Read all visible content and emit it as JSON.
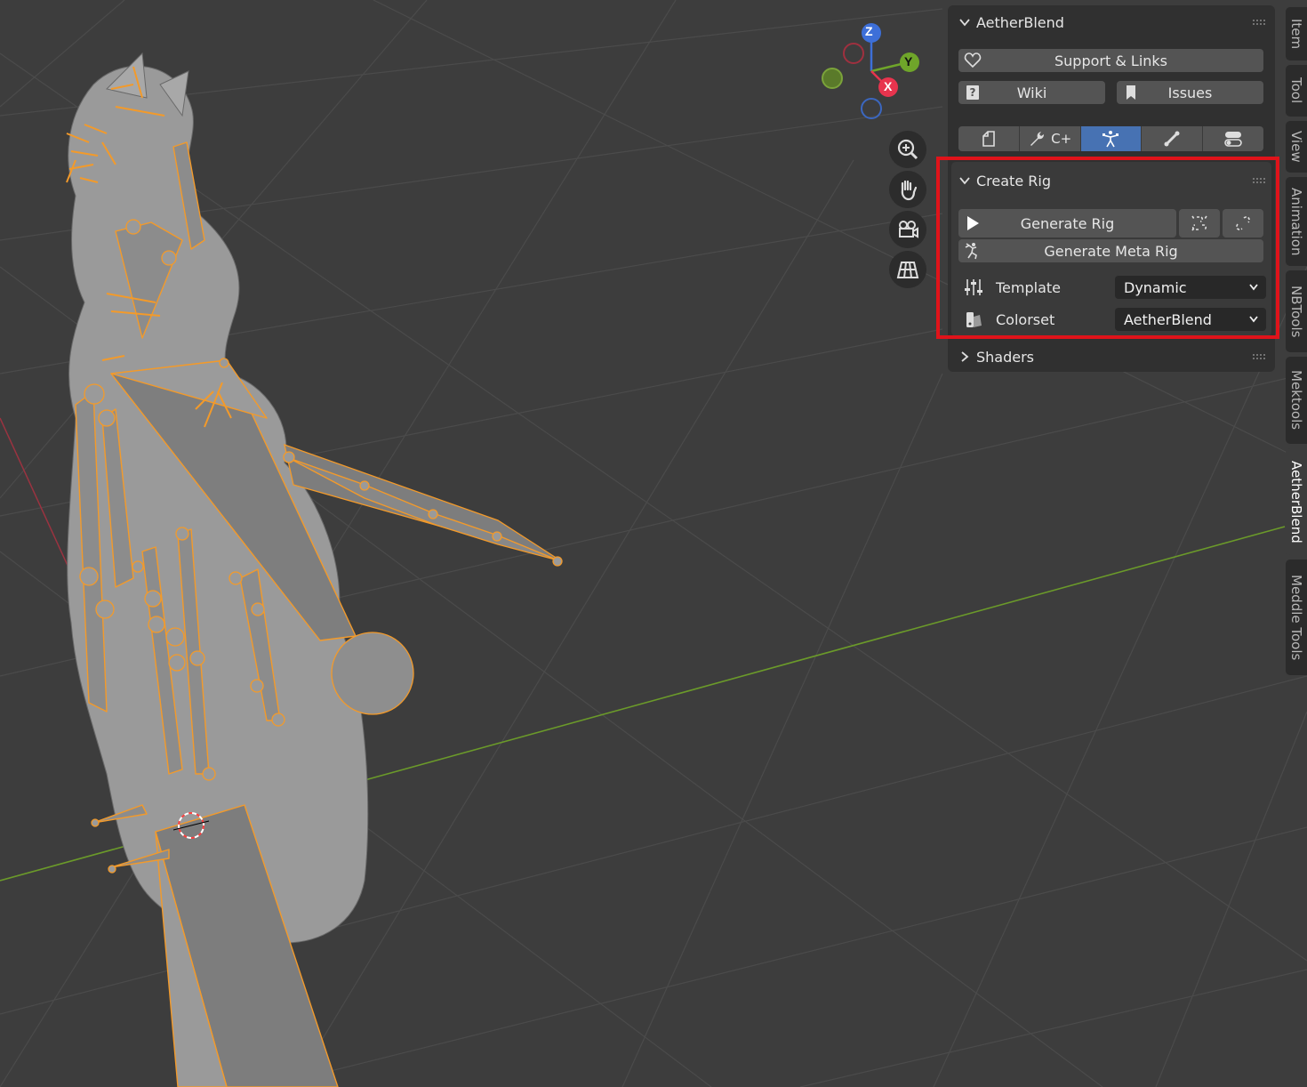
{
  "addon": {
    "title": "AetherBlend",
    "support_label": "Support & Links",
    "wiki_label": "Wiki",
    "issues_label": "Issues"
  },
  "tabs": [
    {
      "icon": "file-icon",
      "label": ""
    },
    {
      "icon": "wrench-icon",
      "label": "C+"
    },
    {
      "icon": "armature-pose-icon",
      "label": ""
    },
    {
      "icon": "bone-icon",
      "label": ""
    },
    {
      "icon": "toggles-icon",
      "label": ""
    }
  ],
  "active_tab_color": "#4772b3",
  "create_rig": {
    "title": "Create Rig",
    "generate_rig_label": "Generate Rig",
    "generate_meta_rig_label": "Generate Meta Rig",
    "template_label": "Template",
    "template_value": "Dynamic",
    "colorset_label": "Colorset",
    "colorset_value": "AetherBlend"
  },
  "shaders": {
    "title": "Shaders"
  },
  "side_tabs": [
    "Item",
    "Tool",
    "View",
    "Animation",
    "NBTools",
    "Mektools",
    "AetherBlend",
    "Meddle Tools"
  ],
  "active_side_tab": "AetherBlend",
  "gizmo": {
    "z": "Z",
    "y": "Y",
    "x": "X"
  },
  "nav_icons": [
    "zoom-icon",
    "hand-pan-icon",
    "camera-icon",
    "grid-ortho-icon"
  ],
  "highlight_color": "#e0131a",
  "selection_color": "#f39a2a"
}
